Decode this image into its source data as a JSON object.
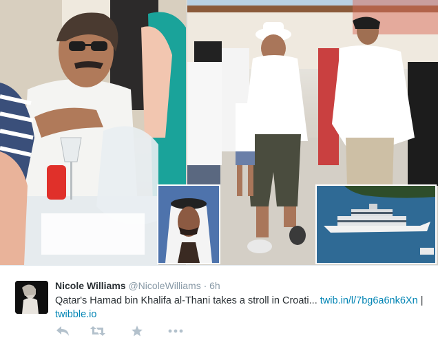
{
  "tweet": {
    "author_name": "Nicole Williams",
    "author_handle": "@NicoleWilliams",
    "separator": "·",
    "timestamp": "6h",
    "text": "Qatar's Hamad bin Khalifa al-Thani takes a stroll in Croati...",
    "link_1": "twib.in/l/7bg6a6nk6Xn",
    "pipe": "|",
    "link_2": "twibble.io"
  },
  "media": {
    "photos": [
      "man-seated-photo",
      "walking-group-photo",
      "portrait-inset",
      "yacht-inset"
    ]
  },
  "actions": [
    {
      "name": "reply-icon"
    },
    {
      "name": "retweet-icon"
    },
    {
      "name": "favorite-icon"
    },
    {
      "name": "more-icon"
    }
  ],
  "colors": {
    "link": "#0084b4",
    "name": "#292f33",
    "muted": "#8899a6",
    "action_icon": "#b3c1cc"
  }
}
